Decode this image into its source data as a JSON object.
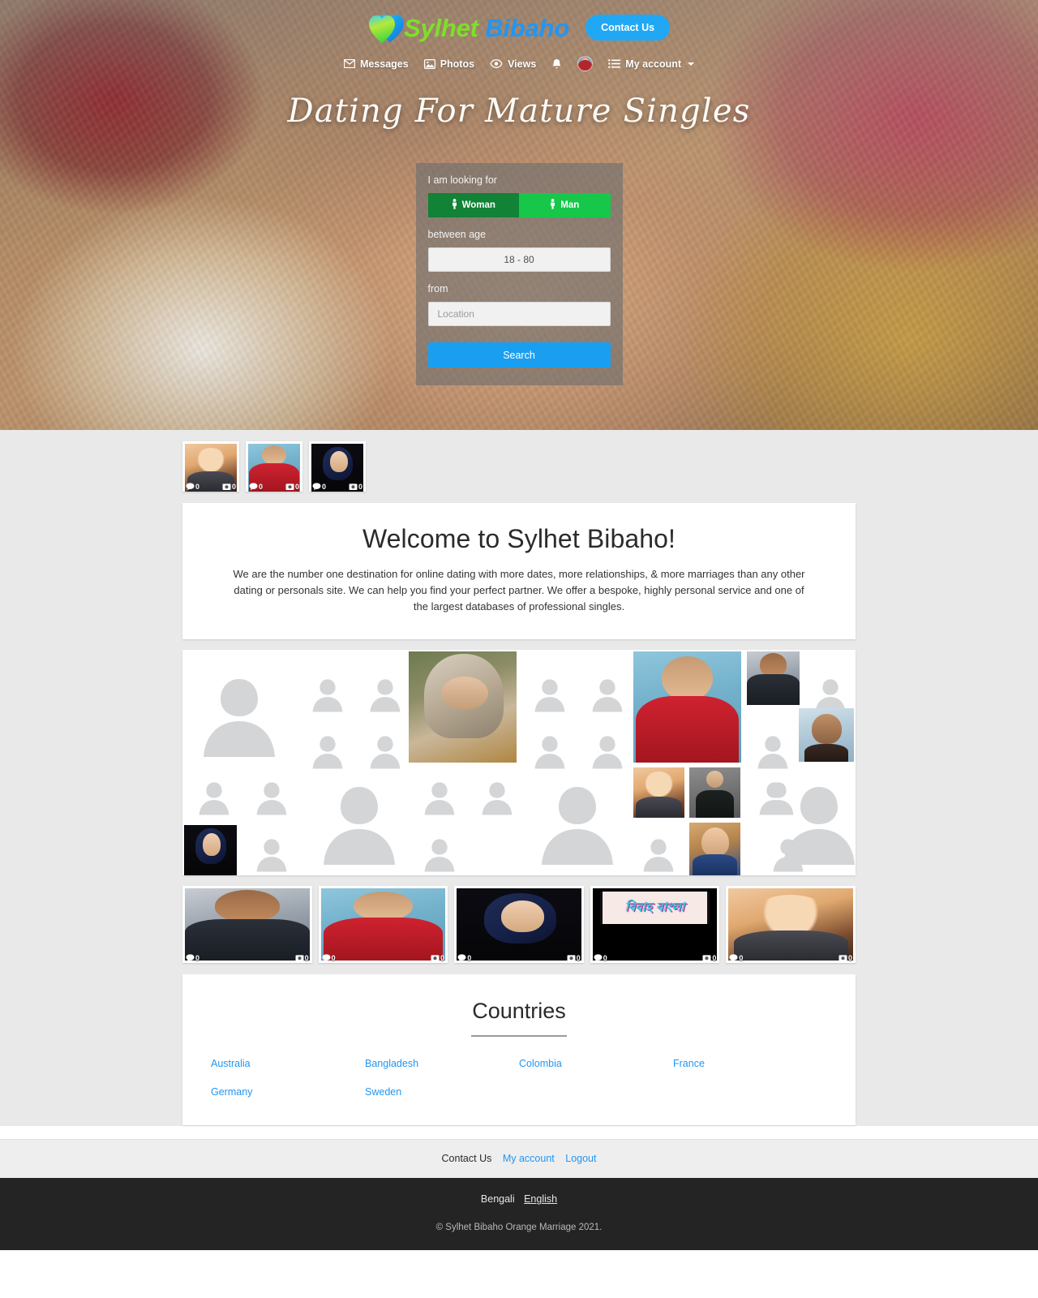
{
  "brand": {
    "word1": "Sylhet",
    "word2": "Bibaho",
    "heart_icon": "heart-logo-icon"
  },
  "header": {
    "contact_button": "Contact Us",
    "nav": [
      {
        "label": "Messages",
        "icon": "envelope-icon"
      },
      {
        "label": "Photos",
        "icon": "image-icon"
      },
      {
        "label": "Views",
        "icon": "eye-icon"
      },
      {
        "label": "",
        "icon": "bell-icon"
      },
      {
        "label": "",
        "icon": "user-avatar"
      },
      {
        "label": "My account",
        "icon": "hamburger-icon"
      }
    ]
  },
  "hero": {
    "title": "Dating For Mature Singles",
    "search": {
      "looking_for_label": "I am looking for",
      "gender_woman": "Woman",
      "gender_man": "Man",
      "age_label": "between age",
      "age_value": "18 - 80",
      "from_label": "from",
      "location_placeholder": "Location",
      "search_button": "Search"
    }
  },
  "thumb_strip": [
    {
      "name": "brunette-smiling",
      "comments": "0",
      "photos": "0"
    },
    {
      "name": "man-red-sweater",
      "comments": "0",
      "photos": "0"
    },
    {
      "name": "woman-navy-hijab",
      "comments": "0",
      "photos": "0"
    }
  ],
  "welcome": {
    "heading": "Welcome to Sylhet Bibaho!",
    "paragraph": "We are the number one destination for online dating with more dates, more relationships, & more marriages than any other dating or personals site. We can help you find your perfect partner. We offer a bespoke, highly personal service and one of the largest databases of professional singles."
  },
  "photo_row": [
    {
      "name": "man-sunglasses-beard",
      "comments": "0",
      "photos": "0"
    },
    {
      "name": "man-red-sweater",
      "comments": "0",
      "photos": "0"
    },
    {
      "name": "woman-navy-hijab",
      "comments": "0",
      "photos": "0"
    },
    {
      "name": "bibaho-bangla-banner",
      "comments": "0",
      "photos": "0",
      "banner_text": "বিবাহ বাংলা"
    },
    {
      "name": "brunette-smiling",
      "comments": "0",
      "photos": "0"
    }
  ],
  "countries": {
    "heading": "Countries",
    "list": [
      "Australia",
      "Bangladesh",
      "Colombia",
      "France",
      "Germany",
      "Sweden"
    ]
  },
  "footer": {
    "links": [
      {
        "label": "Contact Us",
        "style": "dark"
      },
      {
        "label": "My account",
        "style": "blue"
      },
      {
        "label": "Logout",
        "style": "blue"
      }
    ],
    "languages": [
      {
        "label": "Bengali",
        "active": false
      },
      {
        "label": "English",
        "active": true
      }
    ],
    "copyright": "© Sylhet Bibaho Orange Marriage 2021."
  },
  "colors": {
    "accent_blue": "#2196f3",
    "brand_green": "#7de02a",
    "gender_selected": "#128236",
    "gender_alt": "#16c74a",
    "search_blue": "#1a9ff0",
    "footer_dark": "#242424"
  }
}
